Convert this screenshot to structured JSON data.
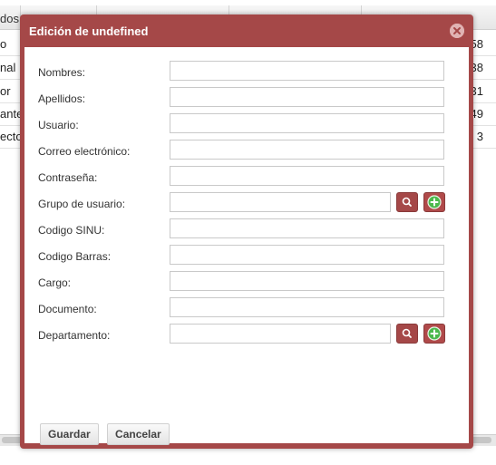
{
  "background_grid": {
    "header_label": "dos",
    "rows": [
      {
        "left": "o",
        "right": "58"
      },
      {
        "left": "nal",
        "right": "38"
      },
      {
        "left": "or",
        "right": "31"
      },
      {
        "left": "ante",
        "right": "49"
      },
      {
        "left": "ecto",
        "right": "3"
      }
    ]
  },
  "dialog": {
    "title": "Edición de undefined",
    "close_icon": "close-icon",
    "fields": [
      {
        "label": "Nombres:",
        "value": ""
      },
      {
        "label": "Apellidos:",
        "value": ""
      },
      {
        "label": "Usuario:",
        "value": ""
      },
      {
        "label": "Correo electrónico:",
        "value": ""
      },
      {
        "label": "Contraseña:",
        "value": ""
      },
      {
        "label": "Grupo de usuario:",
        "value": ""
      },
      {
        "label": "Codigo SINU:",
        "value": ""
      },
      {
        "label": "Codigo Barras:",
        "value": ""
      },
      {
        "label": "Cargo:",
        "value": ""
      },
      {
        "label": "Documento:",
        "value": ""
      },
      {
        "label": "Departamento:",
        "value": ""
      }
    ],
    "buttons": {
      "save": "Guardar",
      "cancel": "Cancelar"
    }
  },
  "colors": {
    "dialog_frame": "#a54848",
    "add_icon": "#4cb84c"
  }
}
